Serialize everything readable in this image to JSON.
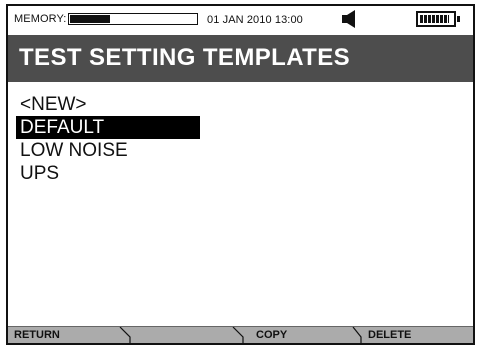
{
  "status_bar": {
    "memory_label": "MEMORY:",
    "memory_used_fraction": 0.32,
    "datetime": "01 JAN 2010 13:00",
    "speaker_icon": "speaker-icon",
    "battery_icon": "battery-icon",
    "battery_level_fraction": 0.9
  },
  "header": {
    "title": "TEST SETTING TEMPLATES"
  },
  "templates": {
    "items": [
      {
        "label": "<NEW>"
      },
      {
        "label": "DEFAULT",
        "selected": true
      },
      {
        "label": "LOW NOISE"
      },
      {
        "label": "UPS"
      }
    ]
  },
  "softkeys": {
    "key1": "RETURN",
    "key2": "",
    "key3": "COPY",
    "key4": "DELETE"
  },
  "colors": {
    "title_band": "#4d4d4d",
    "softkey_bar": "#ababab",
    "selection": "#000000"
  }
}
